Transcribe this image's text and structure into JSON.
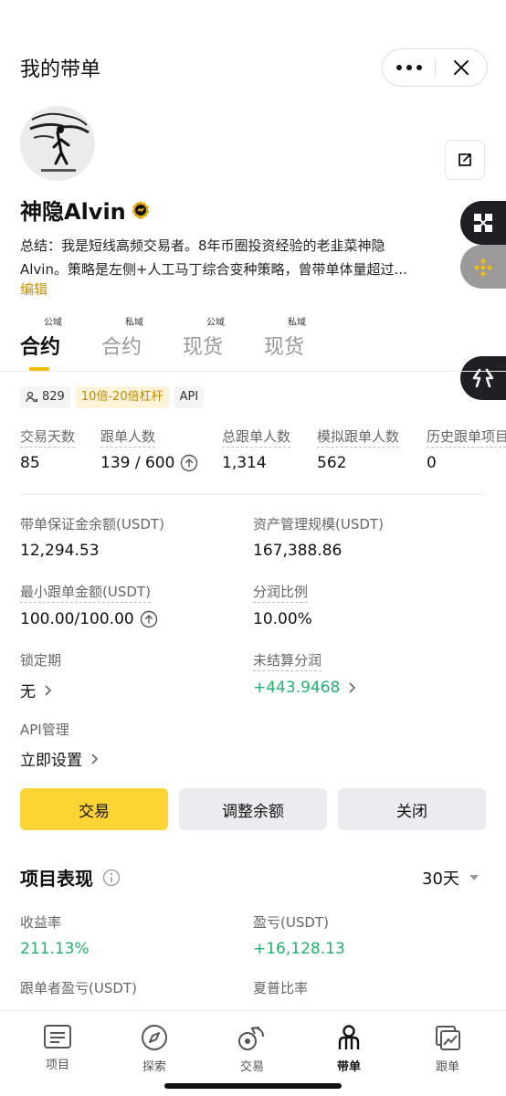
{
  "header": {
    "title": "我的带单"
  },
  "profile": {
    "name": "神隐Alvin",
    "summary_line1": "总结：我是短线高频交易者。8年币圈投资经验的老韭菜神隐",
    "summary_line2": "Alvin。策略是左侧+人工马丁综合变种策略，曾带单体量超过...",
    "edit_label": "编辑"
  },
  "tabs": [
    {
      "badge": "公域",
      "label": "合约"
    },
    {
      "badge": "私域",
      "label": "合约"
    },
    {
      "badge": "公域",
      "label": "现货"
    },
    {
      "badge": "私域",
      "label": "现货"
    }
  ],
  "tags": {
    "followers": "829",
    "leverage": "10倍-20倍杠杆",
    "api": "API"
  },
  "stats": [
    {
      "label": "交易天数",
      "value": "85"
    },
    {
      "label": "跟单人数",
      "value": "139 / 600"
    },
    {
      "label": "总跟单人数",
      "value": "1,314"
    },
    {
      "label": "模拟跟单人数",
      "value": "562"
    },
    {
      "label": "历史跟单项目",
      "value": "0"
    }
  ],
  "details": {
    "margin_balance_label": "带单保证金余额(USDT)",
    "margin_balance_value": "12,294.53",
    "aum_label": "资产管理规模(USDT)",
    "aum_value": "167,388.86",
    "min_copy_label": "最小跟单金额(USDT)",
    "min_copy_value": "100.00/100.00",
    "profit_share_label": "分润比例",
    "profit_share_value": "10.00%",
    "lock_label": "锁定期",
    "lock_value": "无",
    "unsettled_label": "未结算分润",
    "unsettled_value": "+443.9468",
    "api_label": "API管理",
    "api_value": "立即设置"
  },
  "actions": {
    "trade": "交易",
    "adjust": "调整余额",
    "close": "关闭"
  },
  "performance": {
    "title": "项目表现",
    "period": "30天",
    "roi_label": "收益率",
    "roi_value": "211.13%",
    "pnl_label": "盈亏(USDT)",
    "pnl_value": "+16,128.13",
    "follower_pnl_label": "跟单者盈亏(USDT)",
    "sharpe_label": "夏普比率"
  },
  "nav": [
    {
      "label": "项目",
      "icon": "list-icon"
    },
    {
      "label": "探索",
      "icon": "compass-icon"
    },
    {
      "label": "交易",
      "icon": "trade-icon"
    },
    {
      "label": "带单",
      "icon": "lead-trader-icon"
    },
    {
      "label": "跟单",
      "icon": "copy-chart-icon"
    }
  ],
  "colors": {
    "accent": "#fcd535",
    "edit_link": "#c99400",
    "positive": "#20b26c",
    "tab_underline": "#f0c000"
  }
}
